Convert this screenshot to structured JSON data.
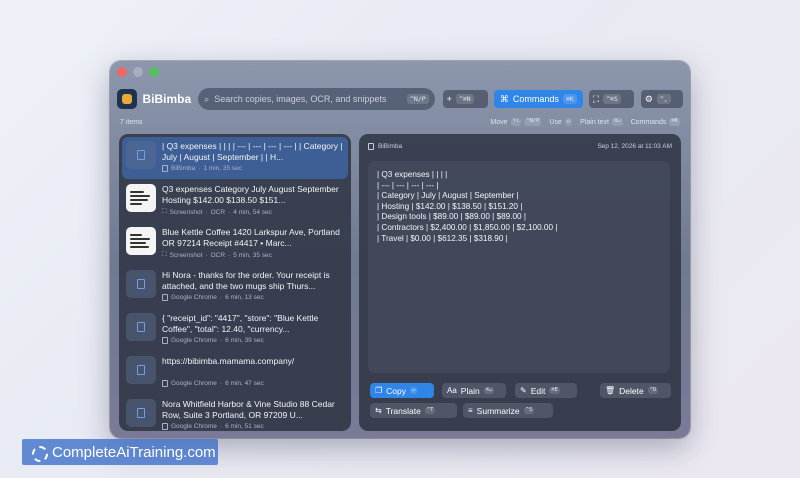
{
  "window": {
    "app_name": "BiBimba"
  },
  "toolbar": {
    "search_placeholder": "Search copies, images, OCR, and snippets",
    "search_shortcut": "^N/P",
    "new_label": "+",
    "new_shortcut": "^⌘N",
    "commands_label": "Commands",
    "commands_shortcut": "⌘K",
    "screenshot_shortcut": "^⌘S",
    "settings_shortcut": "^,"
  },
  "subbar": {
    "count": "7 items",
    "move_label": "Move",
    "move_keys": "↑↓",
    "move_alt": "^N/P",
    "use_label": "Use",
    "use_key": "↵",
    "plain_label": "Plain text",
    "plain_key": "⌘↵",
    "commands_label": "Commands",
    "commands_key": "⌘K"
  },
  "items": [
    {
      "text": "| Q3 expenses | | | | --- | --- | --- | --- | | Category | July | August | September | | H...",
      "source": "BiBimba",
      "time": "1 min, 35 sec",
      "ocr": ""
    },
    {
      "text": "Q3 expenses Category July August September Hosting $142.00 $138.50 $151...",
      "source": "Screenshot",
      "ocr": "OCR",
      "time": "4 min, 54 sec"
    },
    {
      "text": "Blue Kettle Coffee 1420 Larkspur Ave, Portland OR 97214 Receipt #4417 • Marc...",
      "source": "Screenshot",
      "ocr": "OCR",
      "time": "5 min, 35 sec"
    },
    {
      "text": "Hi Nora - thanks for the order. Your receipt is attached, and the two mugs ship Thurs...",
      "source": "Google Chrome",
      "time": "6 min, 13 sec",
      "ocr": ""
    },
    {
      "text": "{ \"receipt_id\": \"4417\", \"store\": \"Blue Kettle Coffee\", \"total\": 12.40, \"currency...",
      "source": "Google Chrome",
      "time": "6 min, 39 sec",
      "ocr": ""
    },
    {
      "text": "https://bibimba.mamama.company/",
      "source": "Google Chrome",
      "time": "6 min, 47 sec",
      "ocr": ""
    },
    {
      "text": "Nora Whitfield Harbor & Vine Studio 88 Cedar Row, Suite 3 Portland, OR 97209 U...",
      "source": "Google Chrome",
      "time": "6 min, 51 sec",
      "ocr": ""
    }
  ],
  "detail": {
    "source": "BiBimba",
    "timestamp": "Sep 12, 2026 at 11:03 AM",
    "lines": [
      "| Q3 expenses | | | |",
      "| --- | --- | --- | --- |",
      "| Category | July | August | September |",
      "| Hosting | $142.00 | $138.50 | $151.20 |",
      "| Design tools | $89.00 | $89.00 | $89.00 |",
      "| Contractors | $2,400.00 | $1,850.00 | $2,100.00 |",
      "| Travel | $0.00 | $612.35 | $318.90 |"
    ]
  },
  "actions": {
    "copy_label": "Copy",
    "copy_key": "↵",
    "plain_label": "Plain",
    "plain_key": "⌘↵",
    "edit_label": "Edit",
    "edit_key": "⌘E",
    "delete_label": "Delete",
    "delete_key": "^D",
    "translate_label": "Translate",
    "translate_key": "^T",
    "summarize_label": "Summarize",
    "summarize_key": "^S"
  },
  "watermark": {
    "text": "CompleteAiTraining.com"
  },
  "colors": {
    "accent": "#2f85e8",
    "selected": "#4278cd"
  }
}
